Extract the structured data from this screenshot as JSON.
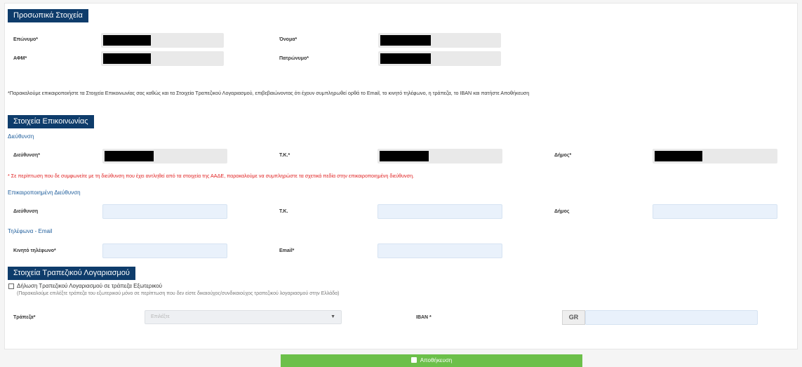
{
  "personal": {
    "title": "Προσωπικά Στοιχεία",
    "surname_label": "Επώνυμο*",
    "name_label": "Όνομα*",
    "afm_label": "ΑΦΜ*",
    "father_label": "Πατρώνυμο*"
  },
  "instruction": "*Παρακαλούμε επικαιροποιήστε τα Στοιχεία Επικοινωνίας σας καθώς και τα Στοιχεία Τραπεζικού Λογαριασμού, επιβεβαιώνοντας ότι έχουν συμπληρωθεί ορθά το Email, το κινητό τηλέφωνο, η τράπεζα, το IBAN και πατήστε Αποθήκευση",
  "contact": {
    "title": "Στοιχεία Επικοινωνίας",
    "address_sub": "Διεύθυνση",
    "address_label": "Διεύθυνση*",
    "tk_label": "Τ.Κ.*",
    "municipality_label": "Δήμος*",
    "warning": "* Σε περίπτωση που δε συμφωνείτε με τη διεύθυνση που έχει αντληθεί από τα στοιχεία της ΑΑΔΕ, παρακαλούμε να συμπληρώστε τα σχετικά πεδία στην επικαιροποιημένη διεύθυνση.",
    "updated_sub": "Επικαιροποιημένη Διεύθυνση",
    "upd_address_label": "Διεύθυνση",
    "upd_tk_label": "Τ.Κ.",
    "upd_municipality_label": "Δήμος",
    "phone_sub": "Τηλέφωνα - Email",
    "mobile_label": "Κινητό τηλέφωνο*",
    "email_label": "Email*"
  },
  "bank": {
    "title": "Στοιχεία Τραπεζικού Λογαριασμού",
    "foreign_label": "Δήλωση Τραπεζικού Λογαριασμού σε τράπεζα Εξωτερικού",
    "foreign_hint": "(Παρακαλούμε επιλέξτε τράπεζα του εξωτερικού μόνο σε περίπτωση που δεν είστε δικαιούχος/συνδικαιούχος τραπεζικού λογαριασμού στην Ελλάδα)",
    "bank_label": "Τράπεζα*",
    "bank_placeholder": "Επιλέξτε",
    "iban_label": "IBAN *",
    "iban_prefix": "GR"
  },
  "save_label": "Αποθήκευση",
  "icons": {
    "caret": "chevron-down-icon",
    "save": "floppy-disk-icon"
  },
  "colors": {
    "section_header": "#0e3c6b",
    "save_button": "#6cc04a",
    "warning_text": "#e02020"
  }
}
